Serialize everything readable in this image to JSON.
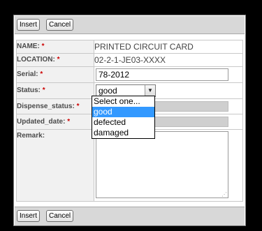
{
  "toolbar": {
    "insert_label": "Insert",
    "cancel_label": "Cancel"
  },
  "fields": {
    "name": {
      "label": "NAME:",
      "required": "*",
      "value": "PRINTED CIRCUIT CARD"
    },
    "location": {
      "label": "LOCATION:",
      "required": "*",
      "value": "02-2-1-JE03-XXXX"
    },
    "serial": {
      "label": "Serial:",
      "required": "*",
      "value": "78-2012"
    },
    "status": {
      "label": "Status:",
      "required": "*",
      "value": "good"
    },
    "dispense_status": {
      "label": "Dispense_status:",
      "required": "*"
    },
    "updated_date": {
      "label": "Updated_date:",
      "required": "*"
    },
    "remark": {
      "label": "Remark:"
    }
  },
  "status_dropdown": {
    "options": [
      "Select one...",
      "good",
      "defected",
      "damaged"
    ],
    "selected": "good"
  },
  "colors": {
    "background_frame": "#000000",
    "required_marker": "#cc0000",
    "dropdown_highlight": "#3399ff",
    "toolbar_bg": "#d8d8d8",
    "disabled_field": "#cfcfcf"
  },
  "icons": {
    "select_arrow": "chevron-down-icon",
    "resize_grip": "resize-grip-icon"
  }
}
